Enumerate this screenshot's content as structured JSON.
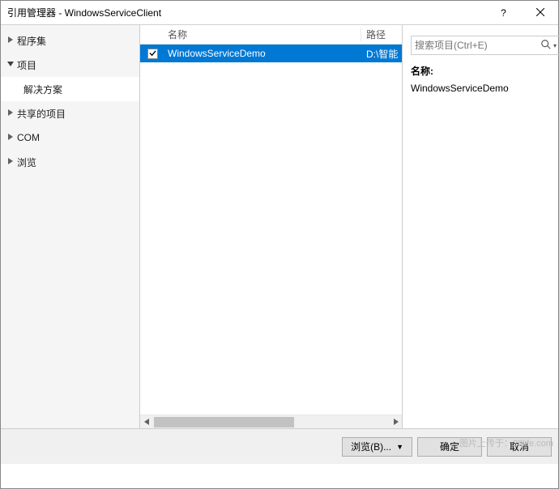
{
  "window": {
    "title": "引用管理器 - WindowsServiceClient"
  },
  "sidebar": {
    "items": [
      {
        "label": "程序集",
        "expanded": false,
        "selected": false
      },
      {
        "label": "项目",
        "expanded": true,
        "selected": true
      },
      {
        "label": "解决方案",
        "sub": true,
        "selected": true
      },
      {
        "label": "共享的项目",
        "expanded": false,
        "selected": false
      },
      {
        "label": "COM",
        "expanded": false,
        "selected": false
      },
      {
        "label": "浏览",
        "expanded": false,
        "selected": false
      }
    ]
  },
  "search": {
    "placeholder": "搜索项目(Ctrl+E)"
  },
  "list": {
    "columns": {
      "name": "名称",
      "path": "路径"
    },
    "rows": [
      {
        "checked": true,
        "name": "WindowsServiceDemo",
        "path": "D:\\智能",
        "selected": true
      }
    ]
  },
  "details": {
    "label": "名称:",
    "value": "WindowsServiceDemo"
  },
  "footer": {
    "browse": "浏览(B)...",
    "ok": "确定",
    "cancel": "取消"
  },
  "watermark": "图片上传于：28life.com"
}
